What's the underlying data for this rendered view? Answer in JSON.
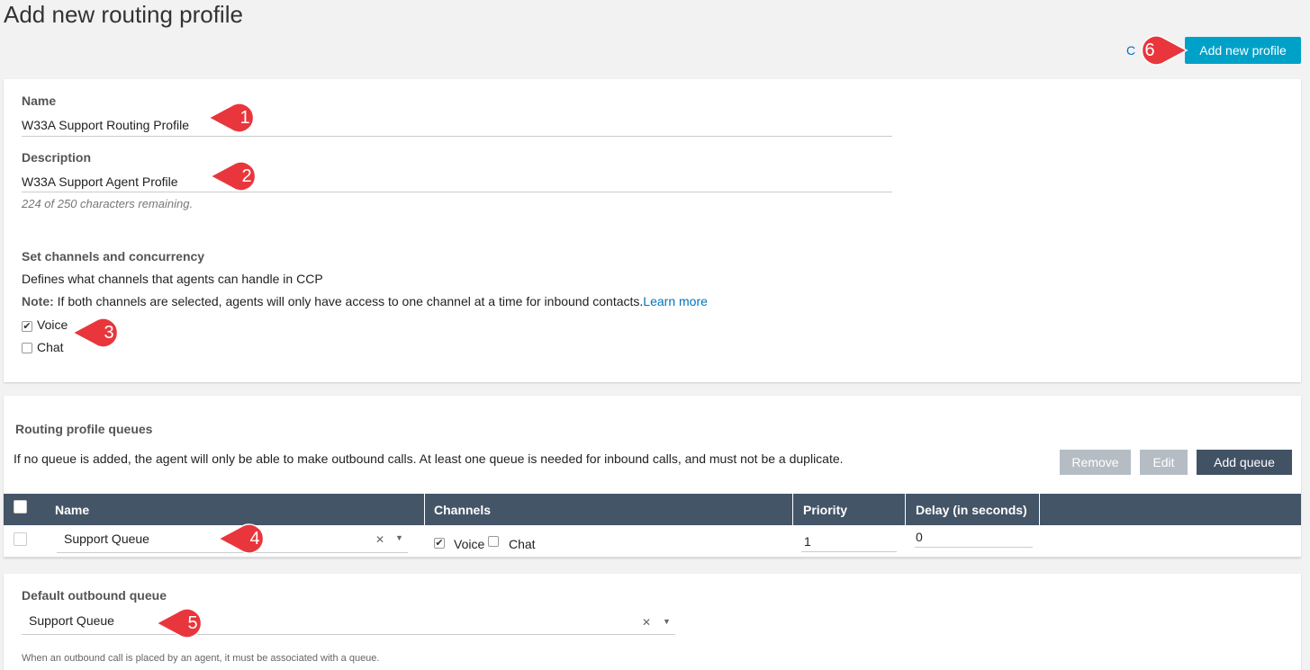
{
  "page": {
    "title": "Add new routing profile"
  },
  "toolbar": {
    "cancel_label": "C",
    "add_profile_label": "Add new profile"
  },
  "form": {
    "name_label": "Name",
    "name_value": "W33A Support Routing Profile",
    "description_label": "Description",
    "description_value": "W33A Support Agent Profile",
    "char_remaining": "224 of 250 characters remaining.",
    "channels_heading": "Set channels and concurrency",
    "channels_desc": "Defines what channels that agents can handle in CCP",
    "note_label": "Note:",
    "note_text": " If both channels are selected, agents will only have access to one channel at a time for inbound contacts.",
    "learn_more": "Learn more",
    "voice_label": "Voice",
    "voice_checked": true,
    "chat_label": "Chat",
    "chat_checked": false
  },
  "queues": {
    "heading": "Routing profile queues",
    "desc": "If no queue is added, the agent will only be able to make outbound calls. At least one queue is needed for inbound calls, and must not be a duplicate.",
    "remove_label": "Remove",
    "edit_label": "Edit",
    "add_label": "Add queue",
    "columns": [
      "Name",
      "Channels",
      "Priority",
      "Delay (in seconds)"
    ],
    "row": {
      "queue_name": "Support Queue",
      "voice_label": "Voice",
      "chat_label": "Chat",
      "priority": "1",
      "delay": "0"
    }
  },
  "outbound": {
    "label": "Default outbound queue",
    "value": "Support Queue",
    "hint": "When an outbound call is placed by an agent, it must be associated with a queue."
  },
  "callouts": [
    "1",
    "2",
    "3",
    "4",
    "5",
    "6"
  ],
  "colors": {
    "accent": "#00a1c9",
    "table_header": "#445568",
    "callout": "#e8363c"
  }
}
